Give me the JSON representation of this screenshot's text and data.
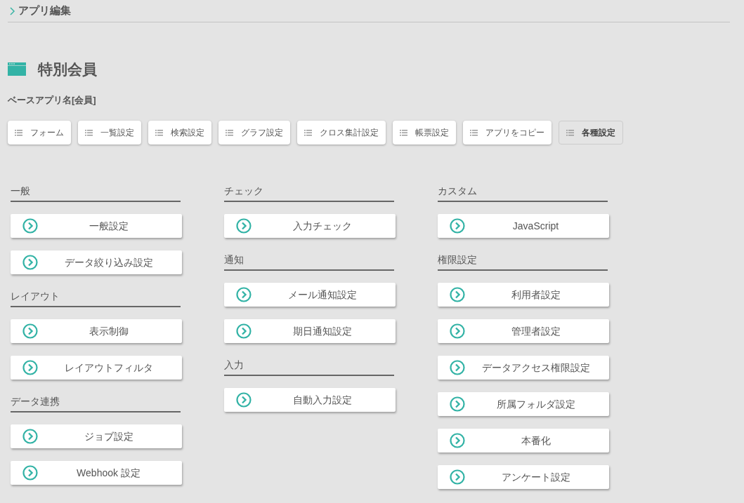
{
  "breadcrumb": "アプリ編集",
  "app_title": "特別会員",
  "base_app": "ベースアプリ名[会員]",
  "tabs": [
    {
      "label": "フォーム",
      "selected": false
    },
    {
      "label": "一覧設定",
      "selected": false
    },
    {
      "label": "検索設定",
      "selected": false
    },
    {
      "label": "グラフ設定",
      "selected": false
    },
    {
      "label": "クロス集計設定",
      "selected": false
    },
    {
      "label": "帳票設定",
      "selected": false
    },
    {
      "label": "アプリをコピー",
      "selected": false
    },
    {
      "label": "各種設定",
      "selected": true
    }
  ],
  "columns": [
    [
      {
        "heading": "一般",
        "items": [
          "一般設定",
          "データ絞り込み設定"
        ]
      },
      {
        "heading": "レイアウト",
        "items": [
          "表示制御",
          "レイアウトフィルタ"
        ]
      },
      {
        "heading": "データ連携",
        "items": [
          "ジョブ設定",
          "Webhook 設定"
        ]
      }
    ],
    [
      {
        "heading": "チェック",
        "items": [
          "入力チェック"
        ]
      },
      {
        "heading": "通知",
        "items": [
          "メール通知設定",
          "期日通知設定"
        ]
      },
      {
        "heading": "入力",
        "items": [
          "自動入力設定"
        ]
      }
    ],
    [
      {
        "heading": "カスタム",
        "items": [
          "JavaScript"
        ]
      },
      {
        "heading": "権限設定",
        "items": [
          "利用者設定",
          "管理者設定",
          "データアクセス権限設定",
          "所属フォルダ設定",
          "本番化",
          "アンケート設定"
        ]
      }
    ]
  ]
}
